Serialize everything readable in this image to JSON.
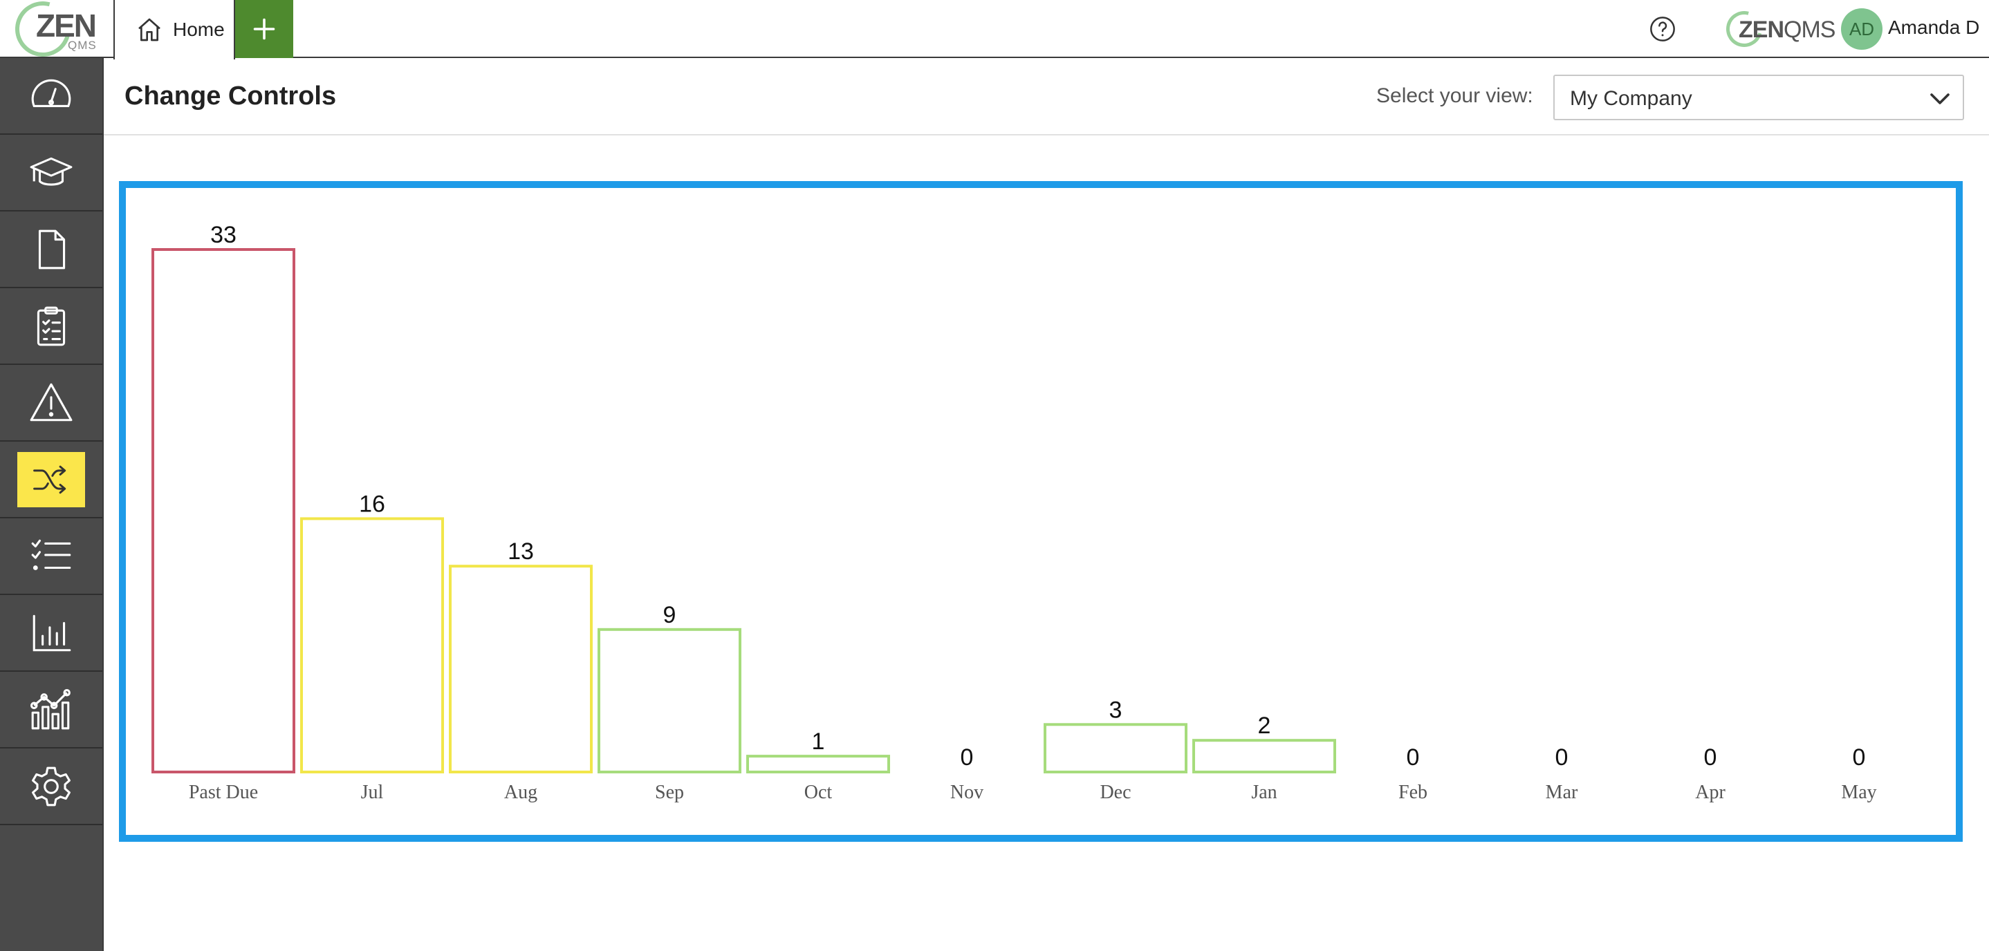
{
  "topbar": {
    "logo": {
      "word": "ZEN",
      "sub": "QMS"
    },
    "tabs": [
      {
        "label": "Home",
        "icon": "home-icon"
      }
    ],
    "add_icon": "plus-icon",
    "help_icon": "help-circle-icon",
    "brand": {
      "bold": "ZEN",
      "light": "QMS"
    },
    "user": {
      "initials": "AD",
      "name": "Amanda D"
    }
  },
  "sidebar": {
    "items": [
      {
        "icon": "dashboard-gauge-icon"
      },
      {
        "icon": "training-cap-icon"
      },
      {
        "icon": "document-icon"
      },
      {
        "icon": "checklist-clipboard-icon"
      },
      {
        "icon": "warning-triangle-icon"
      },
      {
        "icon": "shuffle-change-icon",
        "active": true
      },
      {
        "icon": "task-list-icon"
      },
      {
        "icon": "bar-chart-icon"
      },
      {
        "icon": "analytics-icon"
      },
      {
        "icon": "settings-gear-icon"
      }
    ]
  },
  "header": {
    "title": "Change Controls",
    "view_label": "Select your view:",
    "view_value": "My Company"
  },
  "colors": {
    "accent_border": "#1e9be8",
    "past_due": "#c9566a",
    "due_soon": "#f2e64a",
    "future": "#a6dc7c",
    "active_nav": "#fbe64b",
    "add_button": "#4e8a2e"
  },
  "chart_data": {
    "type": "bar",
    "categories": [
      "Past Due",
      "Jul",
      "Aug",
      "Sep",
      "Oct",
      "Nov",
      "Dec",
      "Jan",
      "Feb",
      "Mar",
      "Apr",
      "May"
    ],
    "values": [
      33,
      16,
      13,
      9,
      1,
      0,
      3,
      2,
      0,
      0,
      0,
      0
    ],
    "bar_colors": [
      "#c9566a",
      "#f2e64a",
      "#f2e64a",
      "#a6dc7c",
      "#a6dc7c",
      "#a6dc7c",
      "#a6dc7c",
      "#a6dc7c",
      "#a6dc7c",
      "#a6dc7c",
      "#a6dc7c",
      "#a6dc7c"
    ],
    "title": "",
    "xlabel": "",
    "ylabel": "",
    "ylim": [
      0,
      33
    ],
    "grid": false,
    "legend": "none",
    "data_labels": true
  }
}
